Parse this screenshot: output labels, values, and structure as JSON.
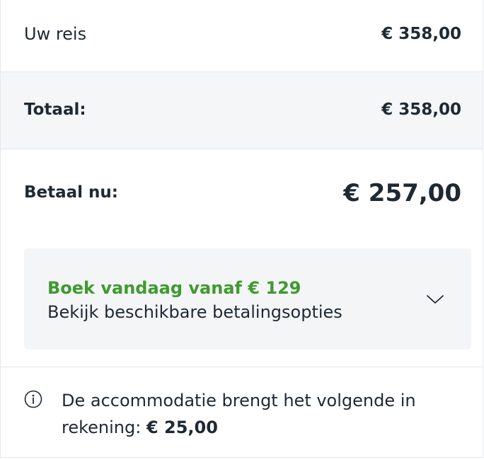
{
  "summary": {
    "trip_label": "Uw reis",
    "trip_value": "€ 358,00",
    "total_label": "Totaal:",
    "total_value": "€ 358,00",
    "pay_now_label": "Betaal nu:",
    "pay_now_value": "€ 257,00"
  },
  "payment_options": {
    "title": "Boek vandaag vanaf € 129",
    "subtitle": "Bekijk beschikbare betalingsopties",
    "icon": "chevron-down-icon"
  },
  "note": {
    "icon": "info-icon",
    "text": "De accommodatie brengt het volgende in rekening:",
    "amount": "€ 25,00"
  },
  "colors": {
    "accent_green": "#3f9a2f",
    "text": "#1f2933",
    "muted_bg": "#f5f6f8",
    "border": "#e3e5e8"
  }
}
